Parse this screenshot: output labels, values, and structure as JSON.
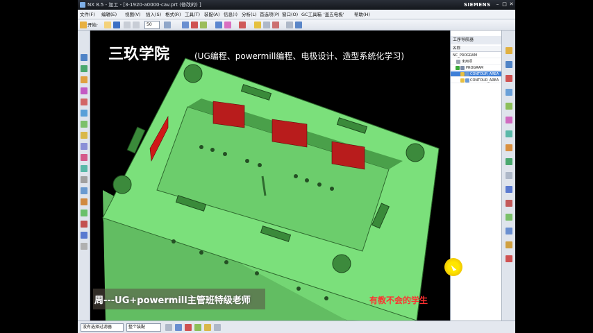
{
  "window": {
    "title": "NX 8.5 - 加工 - [3-1920-a0000-cav.prt (修改的) ]",
    "brand": "SIEMENS",
    "minimize": "–",
    "maximize": "□",
    "close": "✕"
  },
  "menu": {
    "items": [
      "文件(F)",
      "编辑(E)",
      "视图(V)",
      "插入(S)",
      "格式(R)",
      "工具(T)",
      "装配(A)",
      "信息(I)",
      "分析(L)",
      "首选项(P)",
      "窗口(O)",
      "GC工具箱",
      "'盖五电极'",
      "帮助(H)"
    ]
  },
  "toolbar": {
    "start_label": "开始·",
    "zoom_value": "50"
  },
  "viewport": {
    "watermark_title": "三玖学院",
    "watermark_sub": "(UG编程、powermill编程、电极设计、造型系统化学习)",
    "caption_left": "周---UG+powermill主管班特级老师",
    "caption_right": "有教不会的学生"
  },
  "navigator": {
    "title": "工序导航器",
    "column": "名称",
    "rows": [
      {
        "label": "NC_PROGRAM",
        "selected": false
      },
      {
        "label": "未用项",
        "selected": false
      },
      {
        "label": "PROGRAM",
        "selected": false
      },
      {
        "label": "CONTOUR_AREA",
        "selected": true
      },
      {
        "label": "CONTOUR_AREA",
        "selected": false
      }
    ]
  },
  "statusbar": {
    "filter_label": "没有选择过滤器",
    "assembly_label": "整个装配"
  },
  "colors": {
    "part_green": "#7be07b",
    "wall_red": "#b81c1c",
    "selection_blue": "#3e7fd8",
    "caption_red": "#ff3030"
  }
}
